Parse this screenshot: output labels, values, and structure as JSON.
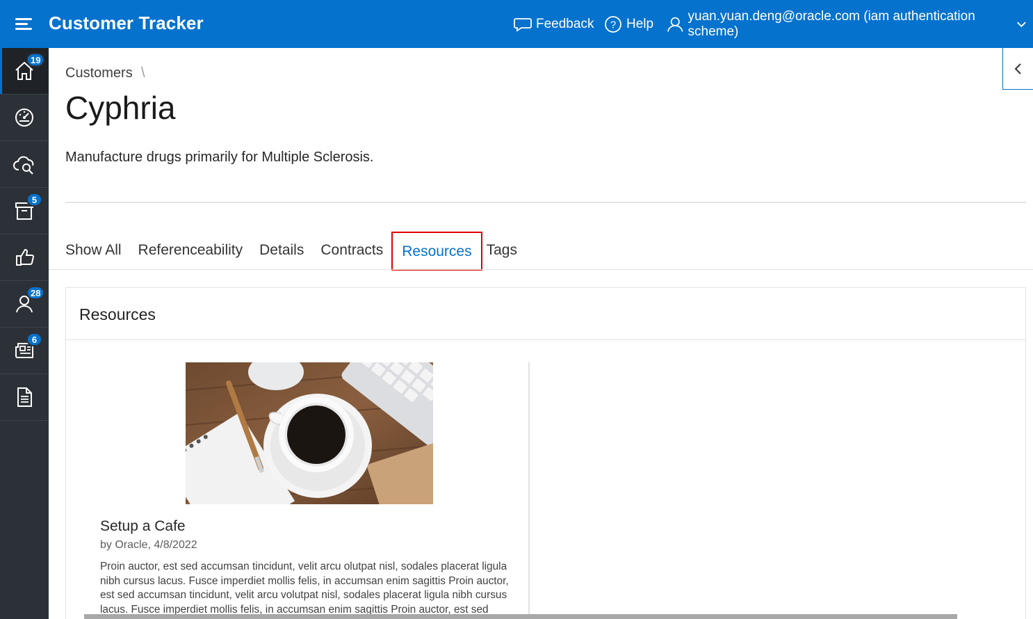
{
  "header": {
    "title": "Customer Tracker",
    "feedback_label": "Feedback",
    "help_label": "Help",
    "user_label": "yuan.yuan.deng@oracle.com (iam authentication scheme)"
  },
  "sidebar": {
    "items": [
      {
        "icon": "home-icon",
        "badge": "19"
      },
      {
        "icon": "dashboard-icon",
        "badge": ""
      },
      {
        "icon": "cloud-search-icon",
        "badge": ""
      },
      {
        "icon": "archive-icon",
        "badge": "5"
      },
      {
        "icon": "thumbs-up-icon",
        "badge": ""
      },
      {
        "icon": "user-icon",
        "badge": "28"
      },
      {
        "icon": "newspaper-icon",
        "badge": "6"
      },
      {
        "icon": "document-icon",
        "badge": ""
      }
    ]
  },
  "breadcrumb": {
    "parent": "Customers",
    "separator": "\\"
  },
  "page": {
    "title": "Cyphria",
    "description": "Manufacture drugs primarily for Multiple Sclerosis."
  },
  "tabs": [
    {
      "label": "Show All"
    },
    {
      "label": "Referenceability"
    },
    {
      "label": "Details"
    },
    {
      "label": "Contracts"
    },
    {
      "label": "Resources"
    },
    {
      "label": "Tags"
    }
  ],
  "resources": {
    "heading": "Resources",
    "card": {
      "title": "Setup a Cafe",
      "meta": "by Oracle, 4/8/2022",
      "body": "Proin auctor, est sed accumsan tincidunt, velit arcu olutpat nisl, sodales placerat ligula nibh cursus lacus. Fusce imperdiet mollis felis, in accumsan enim sagittis Proin auctor, est sed accumsan tincidunt, velit arcu volutpat nisl, sodales placerat ligula nibh cursus lacus. Fusce imperdiet mollis felis, in accumsan enim sagittis Proin auctor, est sed accumsan tincidunt, velit arcu volutpat nisl, sodales placerat ligula nibh cursus lacus."
    }
  },
  "colors": {
    "brand": "#0572ce",
    "nav": "#2c3137",
    "highlight": "#e00000"
  }
}
